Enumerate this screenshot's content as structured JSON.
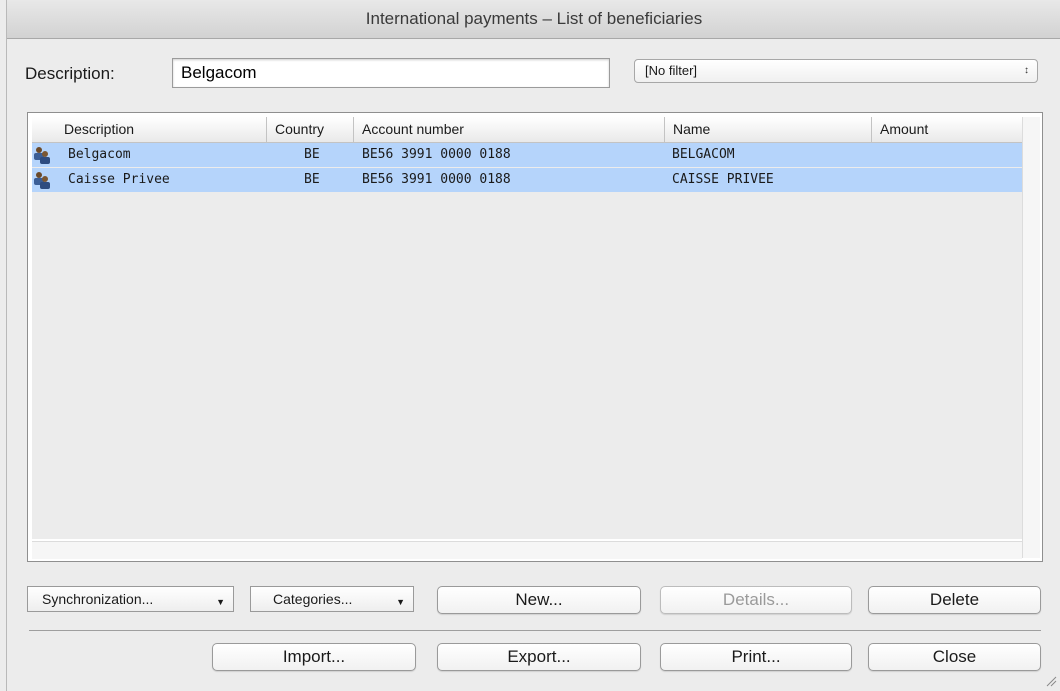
{
  "window": {
    "title": "International payments – List of beneficiaries"
  },
  "description": {
    "label": "Description:",
    "value": "Belgacom"
  },
  "filter": {
    "selected": "[No filter]"
  },
  "table": {
    "columns": [
      "Description",
      "Country",
      "Account number",
      "Name",
      "Amount"
    ],
    "rows": [
      {
        "description": "Belgacom",
        "country": "BE",
        "account": "BE56 3991 0000 0188",
        "name": "BELGACOM",
        "amount": "",
        "icon": "person-icon"
      },
      {
        "description": "Caisse Privee",
        "country": "BE",
        "account": "BE56 3991 0000 0188",
        "name": "CAISSE PRIVEE",
        "amount": "",
        "icon": "person-icon"
      }
    ],
    "selection_color": "#b5d4fb"
  },
  "buttons": {
    "synchronization": "Synchronization...",
    "categories": "Categories...",
    "new": "New...",
    "details": "Details...",
    "delete": "Delete",
    "import": "Import...",
    "export": "Export...",
    "print": "Print...",
    "close": "Close"
  }
}
